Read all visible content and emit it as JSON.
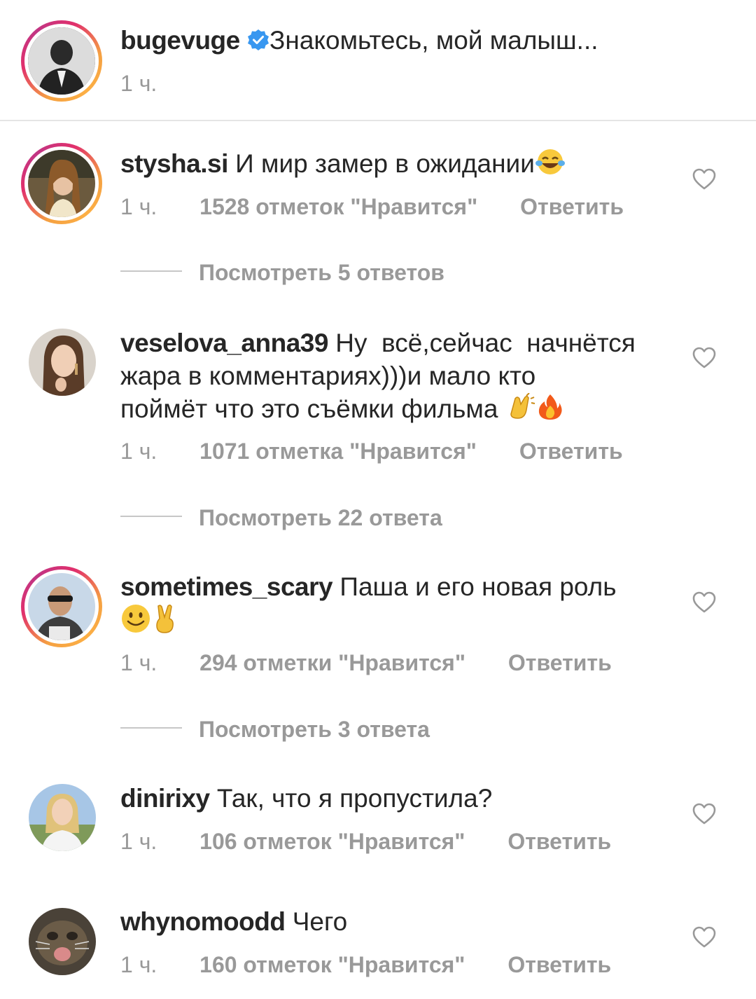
{
  "post": {
    "username": "bugevuge",
    "verified": true,
    "caption": "Знакомьтесь, мой малыш...",
    "time": "1 ч."
  },
  "comments": [
    {
      "username": "stysha.si",
      "text": "И мир замер в ожидании",
      "emojis": [
        "tears-of-joy-emoji"
      ],
      "time": "1 ч.",
      "likes": "1528 отметок \"Нравится\"",
      "reply": "Ответить",
      "view_replies": "Посмотреть 5 ответов",
      "has_story_ring": true
    },
    {
      "username": "veselova_anna39",
      "text_line1": "Ну  всё,сейчас  начнётся",
      "text_line2": "жара в комментариях)))и мало кто",
      "text_line3": "поймёт что это съёмки фильма",
      "emojis": [
        "clapping-hands-emoji",
        "fire-emoji"
      ],
      "time": "1 ч.",
      "likes": "1071 отметка \"Нравится\"",
      "reply": "Ответить",
      "view_replies": "Посмотреть 22 ответа",
      "has_story_ring": false
    },
    {
      "username": "sometimes_scary",
      "text": "Паша и его новая роль",
      "emojis": [
        "smiling-face-emoji",
        "victory-hand-emoji"
      ],
      "time": "1 ч.",
      "likes": "294 отметки \"Нравится\"",
      "reply": "Ответить",
      "view_replies": "Посмотреть 3 ответа",
      "has_story_ring": true
    },
    {
      "username": "dinirixy",
      "text": "Так, что я пропустила?",
      "time": "1 ч.",
      "likes": "106 отметок \"Нравится\"",
      "reply": "Ответить",
      "has_story_ring": false
    },
    {
      "username": "whynomoodd",
      "text": "Чего",
      "time": "1 ч.",
      "likes": "160 отметок \"Нравится\"",
      "reply": "Ответить",
      "has_story_ring": false
    }
  ],
  "colors": {
    "text": "#262626",
    "secondary": "#999999",
    "verified": "#3897f0",
    "divider": "#e5e5e5"
  }
}
